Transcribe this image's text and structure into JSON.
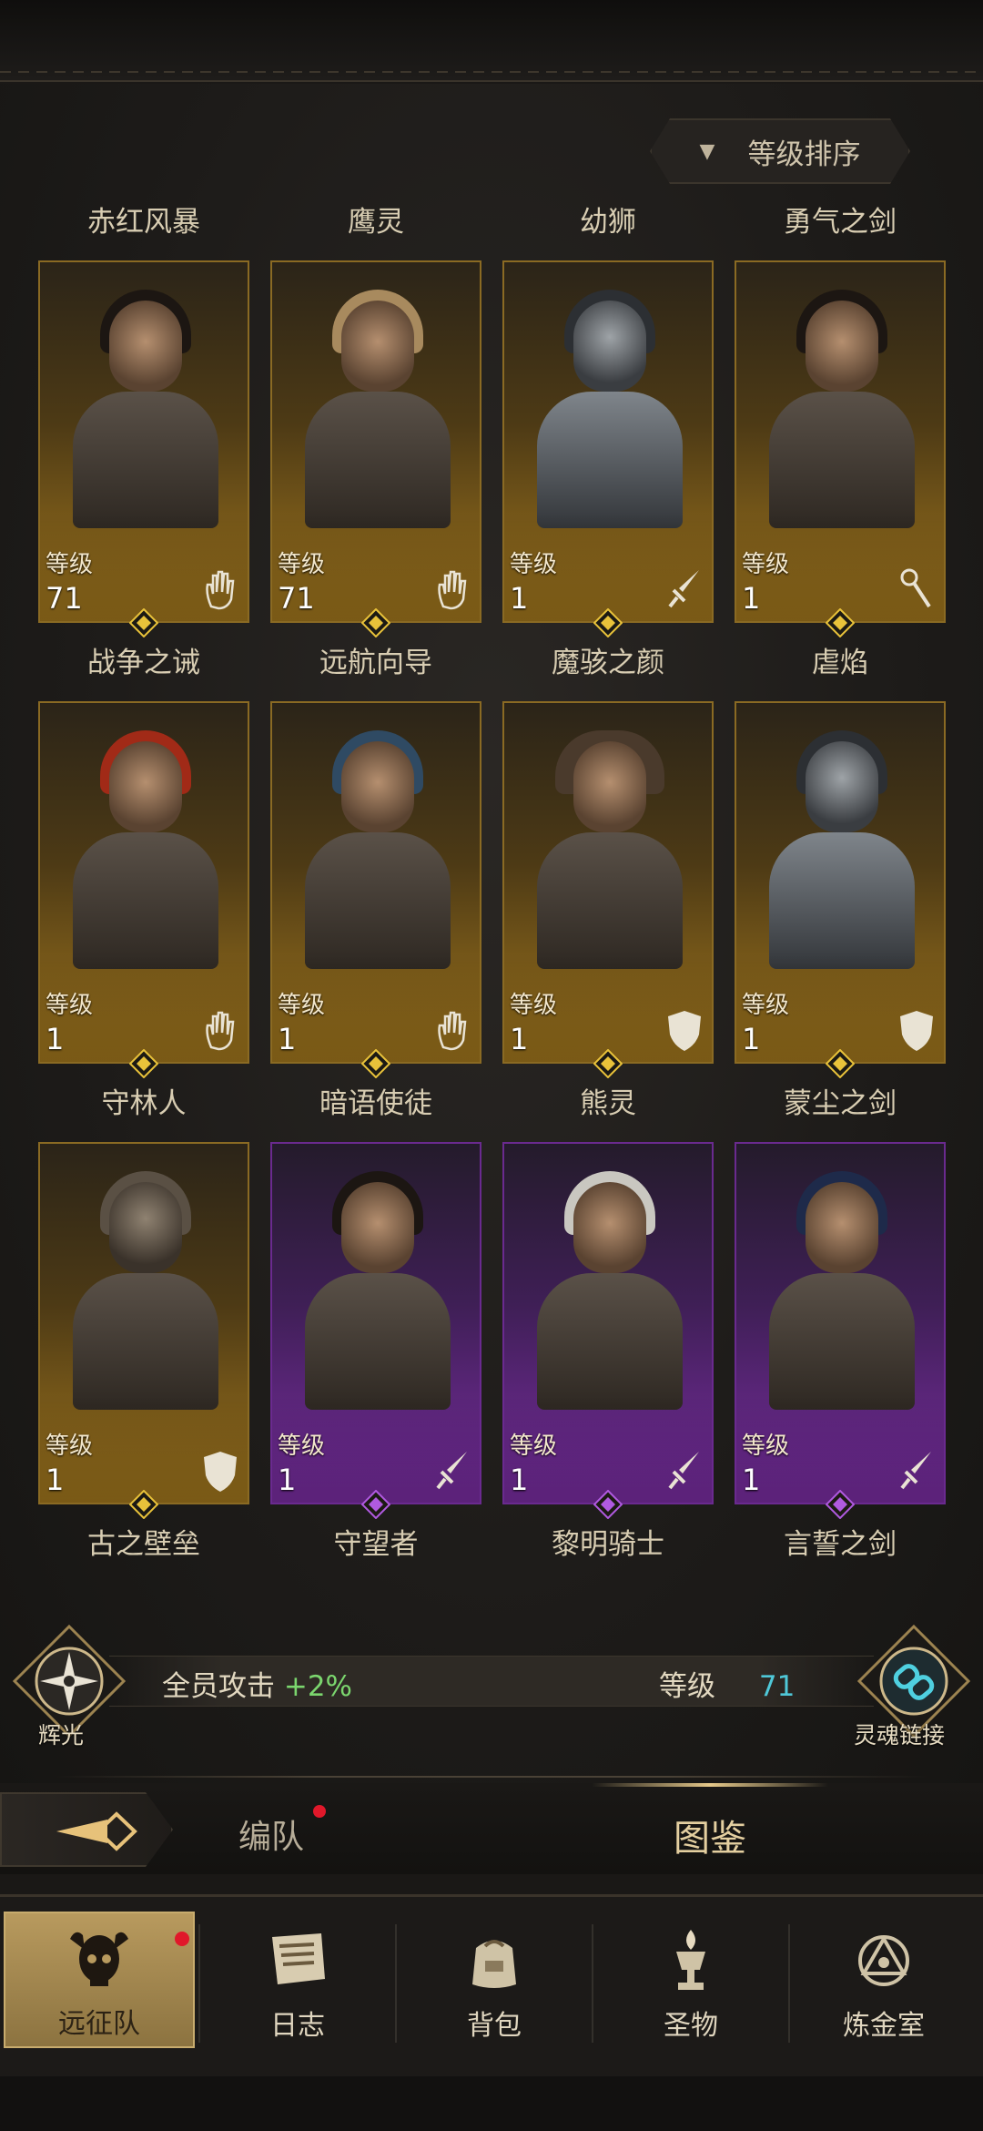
{
  "sort": {
    "label": "等级排序"
  },
  "heroes": [
    {
      "top_name": "赤红风暴",
      "bottom_name": "战争之诫",
      "level_label": "等级",
      "level": "71",
      "rarity": "gold",
      "class_icon": "hand-icon",
      "style": "dark-hair"
    },
    {
      "top_name": "鹰灵",
      "bottom_name": "远航向导",
      "level_label": "等级",
      "level": "71",
      "rarity": "gold",
      "class_icon": "hand-icon",
      "style": "blonde"
    },
    {
      "top_name": "幼狮",
      "bottom_name": "魔骇之颜",
      "level_label": "等级",
      "level": "1",
      "rarity": "gold",
      "class_icon": "sword-icon",
      "style": "helm"
    },
    {
      "top_name": "勇气之剑",
      "bottom_name": "虐焰",
      "level_label": "等级",
      "level": "1",
      "rarity": "gold",
      "class_icon": "staff-icon",
      "style": "dark-hair"
    },
    {
      "top_name": "",
      "bottom_name": "守林人",
      "level_label": "等级",
      "level": "1",
      "rarity": "gold",
      "class_icon": "hand-icon",
      "style": "red"
    },
    {
      "top_name": "",
      "bottom_name": "暗语使徒",
      "level_label": "等级",
      "level": "1",
      "rarity": "gold",
      "class_icon": "hand-icon",
      "style": "hood"
    },
    {
      "top_name": "",
      "bottom_name": "熊灵",
      "level_label": "等级",
      "level": "1",
      "rarity": "gold",
      "class_icon": "shield-icon",
      "style": "bear"
    },
    {
      "top_name": "",
      "bottom_name": "蒙尘之剑",
      "level_label": "等级",
      "level": "1",
      "rarity": "gold",
      "class_icon": "shield-icon",
      "style": "helm"
    },
    {
      "top_name": "",
      "bottom_name": "古之壁垒",
      "level_label": "等级",
      "level": "1",
      "rarity": "gold",
      "class_icon": "shield-icon",
      "style": "dragon"
    },
    {
      "top_name": "",
      "bottom_name": "守望者",
      "level_label": "等级",
      "level": "1",
      "rarity": "purple",
      "class_icon": "sword-icon",
      "style": "dark-hair"
    },
    {
      "top_name": "",
      "bottom_name": "黎明骑士",
      "level_label": "等级",
      "level": "1",
      "rarity": "purple",
      "class_icon": "sword-icon",
      "style": "silver"
    },
    {
      "top_name": "",
      "bottom_name": "言誓之剑",
      "level_label": "等级",
      "level": "1",
      "rarity": "purple",
      "class_icon": "sword-icon",
      "style": "blue"
    }
  ],
  "buff": {
    "left_emblem_label": "辉光",
    "text": "全员攻击",
    "pct": "+2%",
    "level_label": "等级",
    "level_value": "71",
    "right_emblem_label": "灵魂链接"
  },
  "tabs": {
    "formation": "编队",
    "codex": "图鉴"
  },
  "nav": [
    {
      "label": "远征队",
      "icon": "skull-helmet-icon",
      "active": true
    },
    {
      "label": "日志",
      "icon": "scroll-icon",
      "active": false
    },
    {
      "label": "背包",
      "icon": "bag-icon",
      "active": false
    },
    {
      "label": "圣物",
      "icon": "chalice-icon",
      "active": false
    },
    {
      "label": "炼金室",
      "icon": "alchemy-icon",
      "active": false
    }
  ],
  "colors": {
    "gold_card": "#a2771d",
    "purple_card": "#7a2da2",
    "buff_green": "#7bd66e",
    "level_cyan": "#4fc8d8",
    "badge_red": "#e0182a"
  }
}
